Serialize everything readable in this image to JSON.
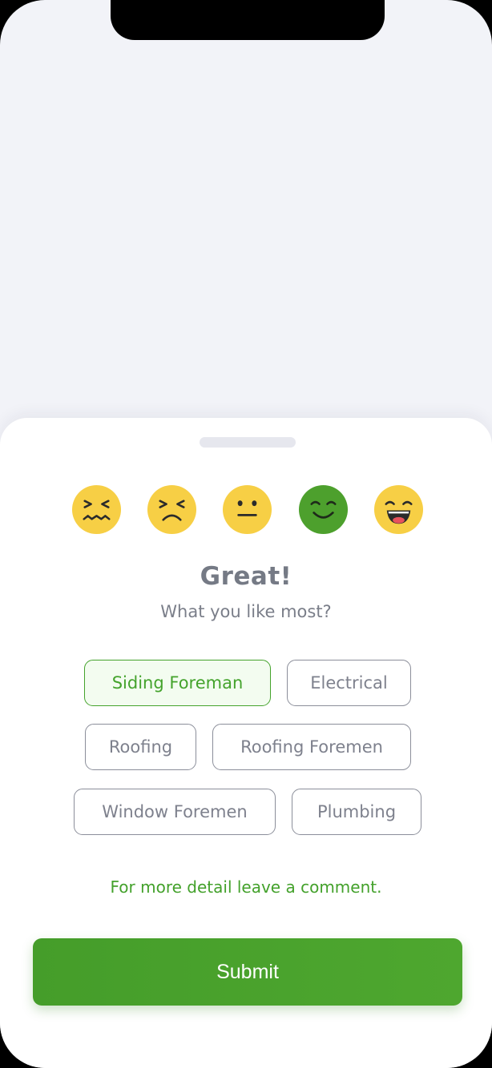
{
  "rating": {
    "options": [
      {
        "icon": "confounded-face-icon",
        "selected": false
      },
      {
        "icon": "persevering-face-icon",
        "selected": false
      },
      {
        "icon": "neutral-face-icon",
        "selected": false
      },
      {
        "icon": "smiling-face-icon",
        "selected": true
      },
      {
        "icon": "grinning-face-icon",
        "selected": false
      }
    ],
    "selected_index": 3
  },
  "heading": "Great!",
  "subheading": "What you like most?",
  "tags": [
    {
      "label": "Siding Foreman",
      "selected": true
    },
    {
      "label": "Electrical",
      "selected": false
    },
    {
      "label": "Roofing",
      "selected": false
    },
    {
      "label": "Roofing Foremen",
      "selected": false
    },
    {
      "label": "Window Foremen",
      "selected": false
    },
    {
      "label": "Plumbing",
      "selected": false
    }
  ],
  "comment_prompt": "For more detail leave a comment.",
  "submit_label": "Submit",
  "colors": {
    "accent": "#44A32C",
    "emoji_yellow": "#F7CF45",
    "emoji_selected": "#4DA02D",
    "text_gray": "#757A85"
  }
}
